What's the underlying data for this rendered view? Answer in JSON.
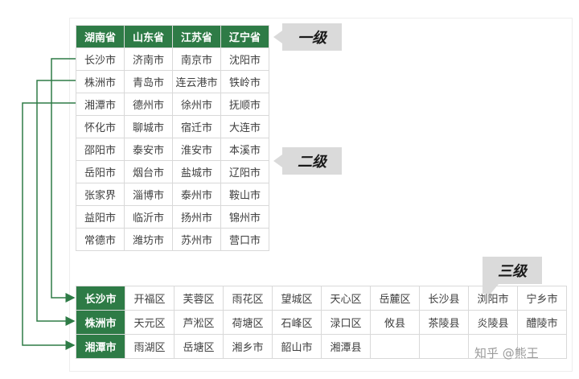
{
  "level1": {
    "headers": [
      "湖南省",
      "山东省",
      "江苏省",
      "辽宁省"
    ],
    "rows": [
      [
        "长沙市",
        "济南市",
        "南京市",
        "沈阳市"
      ],
      [
        "株洲市",
        "青岛市",
        "连云港市",
        "铁岭市"
      ],
      [
        "湘潭市",
        "德州市",
        "徐州市",
        "抚顺市"
      ],
      [
        "怀化市",
        "聊城市",
        "宿迁市",
        "大连市"
      ],
      [
        "邵阳市",
        "泰安市",
        "淮安市",
        "本溪市"
      ],
      [
        "岳阳市",
        "烟台市",
        "盐城市",
        "辽阳市"
      ],
      [
        "张家界",
        "淄博市",
        "泰州市",
        "鞍山市"
      ],
      [
        "益阳市",
        "临沂市",
        "扬州市",
        "锦州市"
      ],
      [
        "常德市",
        "潍坊市",
        "苏州市",
        "营口市"
      ]
    ]
  },
  "level3": {
    "rows": [
      {
        "city": "长沙市",
        "districts": [
          "开福区",
          "芙蓉区",
          "雨花区",
          "望城区",
          "天心区",
          "岳麓区",
          "长沙县",
          "浏阳市",
          "宁乡市"
        ]
      },
      {
        "city": "株洲市",
        "districts": [
          "天元区",
          "芦淞区",
          "荷塘区",
          "石峰区",
          "渌口区",
          "攸县",
          "茶陵县",
          "炎陵县",
          "醴陵市"
        ]
      },
      {
        "city": "湘潭市",
        "districts": [
          "雨湖区",
          "岳塘区",
          "湘乡市",
          "韶山市",
          "湘潭县",
          "",
          "",
          "",
          ""
        ]
      }
    ]
  },
  "callouts": {
    "first": "一级",
    "second": "二级",
    "third": "三级"
  },
  "watermark": "知乎 @熊王",
  "colors": {
    "header_green": "#2e7b46",
    "line_green": "#2e7b46",
    "callout_gray": "#dadada"
  }
}
